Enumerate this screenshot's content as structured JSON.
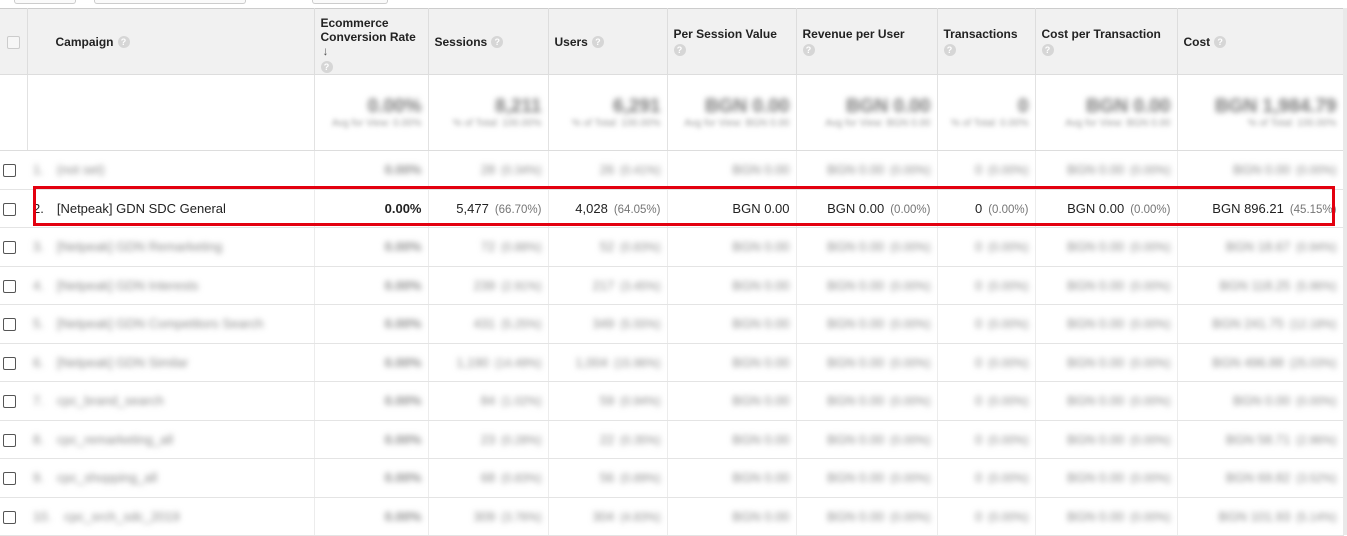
{
  "colors": {
    "highlight": "#e3000f",
    "header_bg": "#f1f1f1"
  },
  "columns": [
    {
      "key": "campaign",
      "label": "Campaign",
      "help_icon": "help-icon"
    },
    {
      "key": "ecr",
      "label_line1": "Ecommerce",
      "label_line2": "Conversion Rate",
      "sort": "↓",
      "help_icon": "help-icon"
    },
    {
      "key": "sessions",
      "label": "Sessions",
      "help_icon": "help-icon"
    },
    {
      "key": "users",
      "label": "Users",
      "help_icon": "help-icon"
    },
    {
      "key": "psv",
      "label": "Per Session Value",
      "help_icon": "help-icon"
    },
    {
      "key": "rpu",
      "label": "Revenue per User",
      "help_icon": "help-icon"
    },
    {
      "key": "tx",
      "label": "Transactions",
      "help_icon": "help-icon"
    },
    {
      "key": "cpt",
      "label": "Cost per Transaction",
      "help_icon": "help-icon"
    },
    {
      "key": "cost",
      "label": "Cost",
      "help_icon": "help-icon"
    }
  ],
  "help_glyph": "?",
  "totals_blurred": [
    {
      "big": "0.00%",
      "small": "Avg for View: 0.00%"
    },
    {
      "big": "8,211",
      "small": "% of Total: 100.00%"
    },
    {
      "big": "6,291",
      "small": "% of Total: 100.00%"
    },
    {
      "big": "BGN 0.00",
      "small": "Avg for View: BGN 0.00"
    },
    {
      "big": "BGN 0.00",
      "small": "Avg for View: BGN 0.00"
    },
    {
      "big": "0",
      "small": "% of Total: 0.00%"
    },
    {
      "big": "BGN 0.00",
      "small": "Avg for View: BGN 0.00"
    },
    {
      "big": "BGN 1,984.79",
      "small": "% of Total: 100.00%"
    }
  ],
  "highlighted_row": {
    "index": "2.",
    "campaign": "[Netpeak] GDN SDC General",
    "ecr": "0.00%",
    "sessions": "5,477",
    "sessions_pct": "(66.70%)",
    "users": "4,028",
    "users_pct": "(64.05%)",
    "psv": "BGN 0.00",
    "rpu": "BGN 0.00",
    "rpu_pct": "(0.00%)",
    "tx": "0",
    "tx_pct": "(0.00%)",
    "cpt": "BGN 0.00",
    "cpt_pct": "(0.00%)",
    "cost": "BGN 896.21",
    "cost_pct": "(45.15%)"
  },
  "rows_blurred": [
    {
      "index": "1.",
      "campaign": "(not set)",
      "ecr": "0.00%",
      "sessions": "28",
      "sessions_pct": "(0.34%)",
      "users": "26",
      "users_pct": "(0.41%)",
      "psv": "BGN 0.00",
      "rpu": "BGN 0.00",
      "rpu_pct": "(0.00%)",
      "tx": "0",
      "tx_pct": "(0.00%)",
      "cpt": "BGN 0.00",
      "cpt_pct": "(0.00%)",
      "cost": "BGN 0.00",
      "cost_pct": "(0.00%)"
    },
    {
      "index": "3.",
      "campaign": "[Netpeak] GDN Remarketing",
      "ecr": "0.00%",
      "sessions": "72",
      "sessions_pct": "(0.88%)",
      "users": "52",
      "users_pct": "(0.83%)",
      "psv": "BGN 0.00",
      "rpu": "BGN 0.00",
      "rpu_pct": "(0.00%)",
      "tx": "0",
      "tx_pct": "(0.00%)",
      "cpt": "BGN 0.00",
      "cpt_pct": "(0.00%)",
      "cost": "BGN 18.67",
      "cost_pct": "(0.94%)"
    },
    {
      "index": "4.",
      "campaign": "[Netpeak] GDN Interests",
      "ecr": "0.00%",
      "sessions": "239",
      "sessions_pct": "(2.91%)",
      "users": "217",
      "users_pct": "(3.45%)",
      "psv": "BGN 0.00",
      "rpu": "BGN 0.00",
      "rpu_pct": "(0.00%)",
      "tx": "0",
      "tx_pct": "(0.00%)",
      "cpt": "BGN 0.00",
      "cpt_pct": "(0.00%)",
      "cost": "BGN 118.25",
      "cost_pct": "(5.96%)"
    },
    {
      "index": "5.",
      "campaign": "[Netpeak] GDN Competitors Search",
      "ecr": "0.00%",
      "sessions": "431",
      "sessions_pct": "(5.25%)",
      "users": "349",
      "users_pct": "(5.55%)",
      "psv": "BGN 0.00",
      "rpu": "BGN 0.00",
      "rpu_pct": "(0.00%)",
      "tx": "0",
      "tx_pct": "(0.00%)",
      "cpt": "BGN 0.00",
      "cpt_pct": "(0.00%)",
      "cost": "BGN 241.75",
      "cost_pct": "(12.18%)"
    },
    {
      "index": "6.",
      "campaign": "[Netpeak] GDN Similar",
      "ecr": "0.00%",
      "sessions": "1,190",
      "sessions_pct": "(14.49%)",
      "users": "1,004",
      "users_pct": "(15.96%)",
      "psv": "BGN 0.00",
      "rpu": "BGN 0.00",
      "rpu_pct": "(0.00%)",
      "tx": "0",
      "tx_pct": "(0.00%)",
      "cpt": "BGN 0.00",
      "cpt_pct": "(0.00%)",
      "cost": "BGN 496.88",
      "cost_pct": "(25.03%)"
    },
    {
      "index": "7.",
      "campaign": "cpc_brand_search",
      "ecr": "0.00%",
      "sessions": "84",
      "sessions_pct": "(1.02%)",
      "users": "59",
      "users_pct": "(0.94%)",
      "psv": "BGN 0.00",
      "rpu": "BGN 0.00",
      "rpu_pct": "(0.00%)",
      "tx": "0",
      "tx_pct": "(0.00%)",
      "cpt": "BGN 0.00",
      "cpt_pct": "(0.00%)",
      "cost": "BGN 0.00",
      "cost_pct": "(0.00%)"
    },
    {
      "index": "8.",
      "campaign": "cpc_remarketing_all",
      "ecr": "0.00%",
      "sessions": "23",
      "sessions_pct": "(0.28%)",
      "users": "22",
      "users_pct": "(0.35%)",
      "psv": "BGN 0.00",
      "rpu": "BGN 0.00",
      "rpu_pct": "(0.00%)",
      "tx": "0",
      "tx_pct": "(0.00%)",
      "cpt": "BGN 0.00",
      "cpt_pct": "(0.00%)",
      "cost": "BGN 58.71",
      "cost_pct": "(2.96%)"
    },
    {
      "index": "9.",
      "campaign": "cpc_shopping_all",
      "ecr": "0.00%",
      "sessions": "68",
      "sessions_pct": "(0.83%)",
      "users": "56",
      "users_pct": "(0.89%)",
      "psv": "BGN 0.00",
      "rpu": "BGN 0.00",
      "rpu_pct": "(0.00%)",
      "tx": "0",
      "tx_pct": "(0.00%)",
      "cpt": "BGN 0.00",
      "cpt_pct": "(0.00%)",
      "cost": "BGN 69.82",
      "cost_pct": "(3.52%)"
    },
    {
      "index": "10.",
      "campaign": "cpc_srch_sdc_2019",
      "ecr": "0.00%",
      "sessions": "309",
      "sessions_pct": "(3.76%)",
      "users": "304",
      "users_pct": "(4.83%)",
      "psv": "BGN 0.00",
      "rpu": "BGN 0.00",
      "rpu_pct": "(0.00%)",
      "tx": "0",
      "tx_pct": "(0.00%)",
      "cpt": "BGN 0.00",
      "cpt_pct": "(0.00%)",
      "cost": "BGN 101.93",
      "cost_pct": "(5.14%)"
    }
  ]
}
